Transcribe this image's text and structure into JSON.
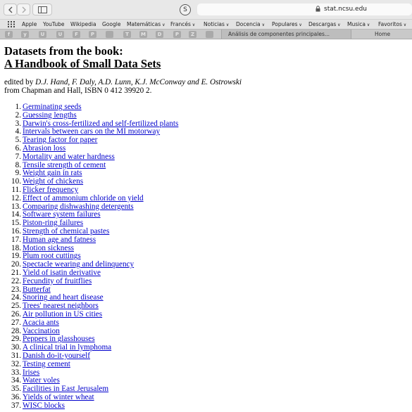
{
  "toolbar": {
    "url": "stat.ncsu.edu"
  },
  "bookmarks": [
    {
      "label": "Apple",
      "dropdown": false
    },
    {
      "label": "YouTube",
      "dropdown": false
    },
    {
      "label": "Wikipedia",
      "dropdown": false
    },
    {
      "label": "Google",
      "dropdown": false
    },
    {
      "label": "Matemáticas",
      "dropdown": true
    },
    {
      "label": "Francés",
      "dropdown": true
    },
    {
      "label": "Noticias",
      "dropdown": true
    },
    {
      "label": "Docencia",
      "dropdown": true
    },
    {
      "label": "Populares",
      "dropdown": true
    },
    {
      "label": "Descargas",
      "dropdown": true
    },
    {
      "label": "Musica",
      "dropdown": true
    },
    {
      "label": "Favoritos",
      "dropdown": true
    }
  ],
  "favicons": [
    "f",
    "y",
    "U",
    "U",
    "F",
    "P",
    "",
    "T",
    "M",
    "D",
    "P",
    "Z",
    ""
  ],
  "tabs": {
    "active": "Análisis de componentes principales...",
    "home": "Home"
  },
  "page": {
    "title_line1": "Datasets from the book:",
    "title_line2": "A Handbook of Small Data Sets",
    "editors_prefix": "edited by ",
    "editors_names": "D.J. Hand, F. Daly, A.D. Lunn, K.J. McConway and E. Ostrowski",
    "publisher": "from Chapman and Hall, ISBN 0 412 39920 2.",
    "datasets": [
      "Germinating seeds",
      "Guessing lengths",
      "Darwin's cross-fertilized and self-fertilized plants",
      "Intervals between cars on the MI motorway",
      "Tearing factor for paper",
      "Abrasion loss",
      "Mortality and water hardness",
      "Tensile strength of cement",
      "Weight gain in rats",
      "Weight of chickens",
      "Flicker frequency",
      "Effect of ammonium chloride on yield",
      "Comparing dishwashing detergents",
      "Software system failures",
      "Piston-ring failures",
      "Strength of chemical pastes",
      "Human age and fatness",
      "Motion sickness",
      "Plum root cuttings",
      "Spectacle wearing and delinquency",
      "Yield of isatin derivative",
      "Fecundity of fruitflies",
      "Butterfat",
      "Snoring and heart disease",
      "Trees' nearest neighbors",
      "Air pollution in US cities",
      "Acacia ants",
      "Vaccination",
      "Peppers in glasshouses",
      "A clinical trial in lymphoma",
      "Danish do-it-yourself",
      "Testing cement",
      "Irises",
      "Water voles",
      "Facilities in East Jerusalem",
      "Yields of winter wheat",
      "WISC blocks"
    ]
  }
}
